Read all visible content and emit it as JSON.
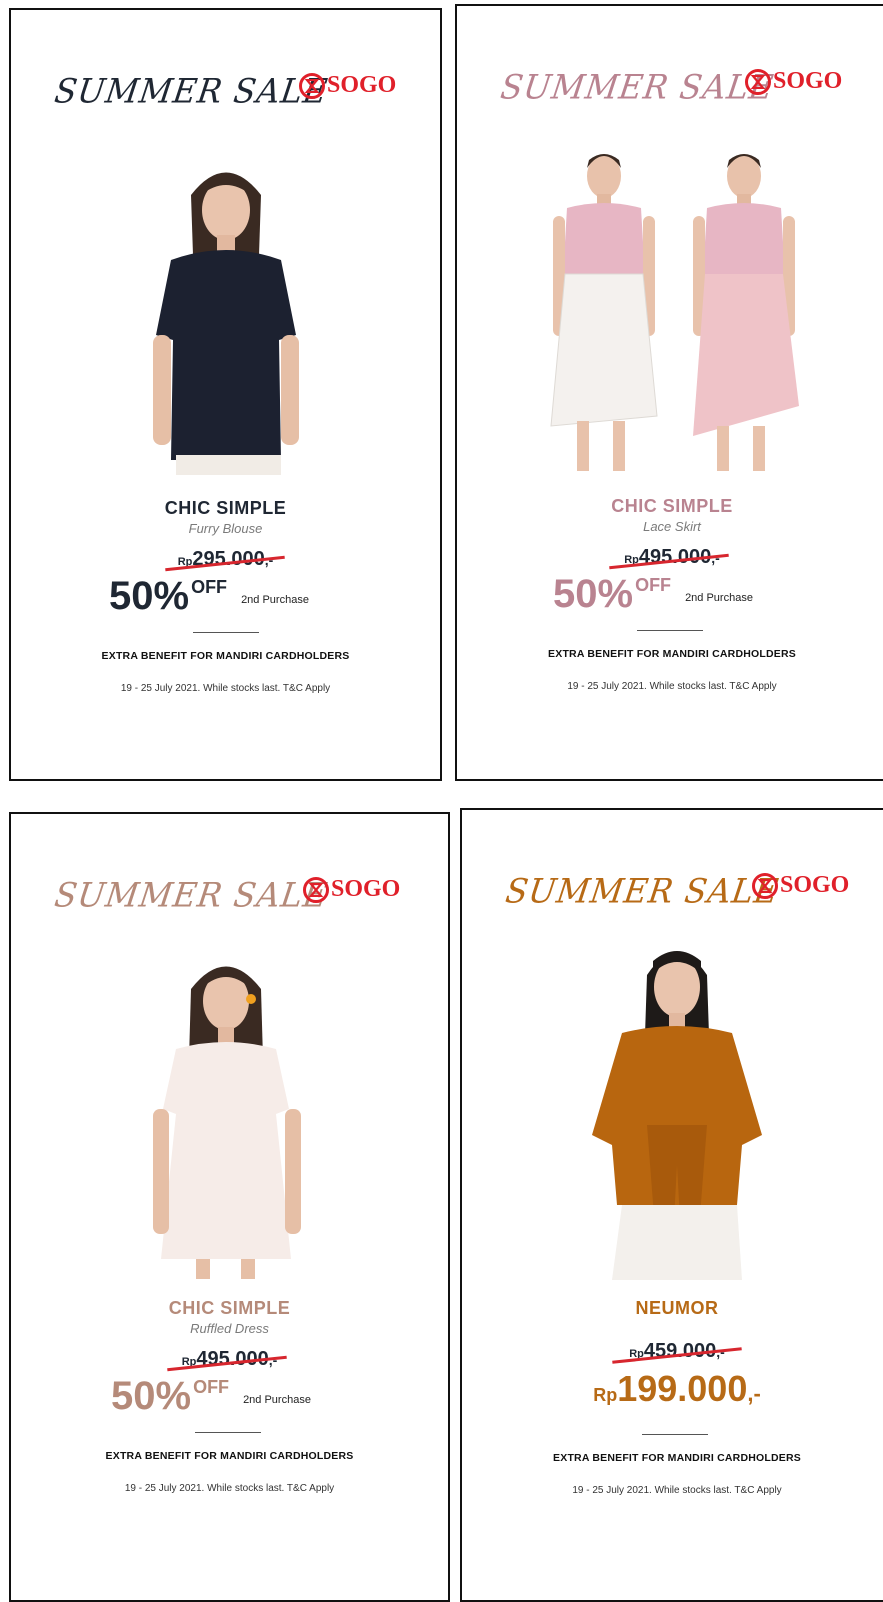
{
  "logo": {
    "text": "SOGO",
    "color": "#e0202a"
  },
  "cards": [
    {
      "title": "SUMMER SALE",
      "accent": "#1f2733",
      "brand": "CHIC SIMPLE",
      "product": "Furry Blouse",
      "old_price": {
        "currency": "Rp",
        "amount": "295.000",
        "suffix": ",-"
      },
      "discount": {
        "percent": "50%",
        "off": "OFF",
        "note": "2nd Purchase"
      },
      "extra": "EXTRA BENEFIT FOR MANDIRI CARDHOLDERS",
      "terms": "19 - 25 July 2021. While stocks last. T&C Apply"
    },
    {
      "title": "SUMMER SALE",
      "accent": "#b98390",
      "brand": "CHIC SIMPLE",
      "product": "Lace Skirt",
      "old_price": {
        "currency": "Rp",
        "amount": "495.000",
        "suffix": ",-"
      },
      "discount": {
        "percent": "50%",
        "off": "OFF",
        "note": "2nd Purchase"
      },
      "extra": "EXTRA BENEFIT FOR MANDIRI CARDHOLDERS",
      "terms": "19 - 25 July 2021. While stocks last. T&C Apply"
    },
    {
      "title": "SUMMER SALE",
      "accent": "#b58a79",
      "brand": "CHIC SIMPLE",
      "product": "Ruffled Dress",
      "old_price": {
        "currency": "Rp",
        "amount": "495.000",
        "suffix": ",-"
      },
      "discount": {
        "percent": "50%",
        "off": "OFF",
        "note": "2nd Purchase"
      },
      "extra": "EXTRA BENEFIT FOR MANDIRI CARDHOLDERS",
      "terms": "19 - 25 July 2021. While stocks last. T&C Apply"
    },
    {
      "title": "SUMMER SALE",
      "accent": "#b76a16",
      "brand": "NEUMOR",
      "old_price": {
        "currency": "Rp",
        "amount": "459.000",
        "suffix": ",-"
      },
      "sale_price": {
        "currency": "Rp",
        "amount": "199.000",
        "suffix": ",-"
      },
      "extra": "EXTRA BENEFIT FOR MANDIRI CARDHOLDERS",
      "terms": "19 - 25 July 2021. While stocks last. T&C Apply"
    }
  ]
}
